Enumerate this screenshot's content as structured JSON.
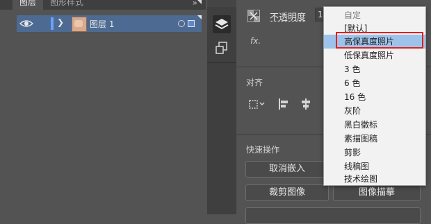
{
  "layers_panel": {
    "tabs": [
      {
        "label": "图层"
      },
      {
        "label": "图形样式"
      }
    ],
    "tab_menu": "»",
    "layer": {
      "name": "图层 1"
    }
  },
  "properties": {
    "opacity_label": "不透明度",
    "opacity_value": "1",
    "fx_label": "fx.",
    "align_title": "对齐",
    "quick_actions_title": "快速操作",
    "buttons": {
      "unembed": "取消嵌入",
      "crop": "裁剪图像",
      "trace": "图像描摹"
    }
  },
  "trace_menu": {
    "items": [
      {
        "label": "自定",
        "state": "disabled"
      },
      {
        "label": "[默认]",
        "state": "normal"
      },
      {
        "label": "高保真度照片",
        "state": "selected"
      },
      {
        "label": "低保真度照片",
        "state": "normal"
      },
      {
        "label": "3 色",
        "state": "normal"
      },
      {
        "label": "6 色",
        "state": "normal"
      },
      {
        "label": "16 色",
        "state": "normal"
      },
      {
        "label": "灰阶",
        "state": "normal"
      },
      {
        "label": "黑白徽标",
        "state": "normal"
      },
      {
        "label": "素描图稿",
        "state": "normal"
      },
      {
        "label": "剪影",
        "state": "normal"
      },
      {
        "label": "线稿图",
        "state": "normal"
      },
      {
        "label": "技术绘图",
        "state": "normal"
      }
    ]
  },
  "colors": {
    "panel_bg": "#535353",
    "selected_layer": "#4d6b92",
    "menu_highlight": "#9ec3ea",
    "callout": "#e02020"
  },
  "icons": [
    "eye-icon",
    "chevron-right-icon",
    "layers-icon",
    "artboards-icon",
    "opacity-checker-icon",
    "align-to-icon",
    "align-left-icon",
    "align-center-icon"
  ]
}
